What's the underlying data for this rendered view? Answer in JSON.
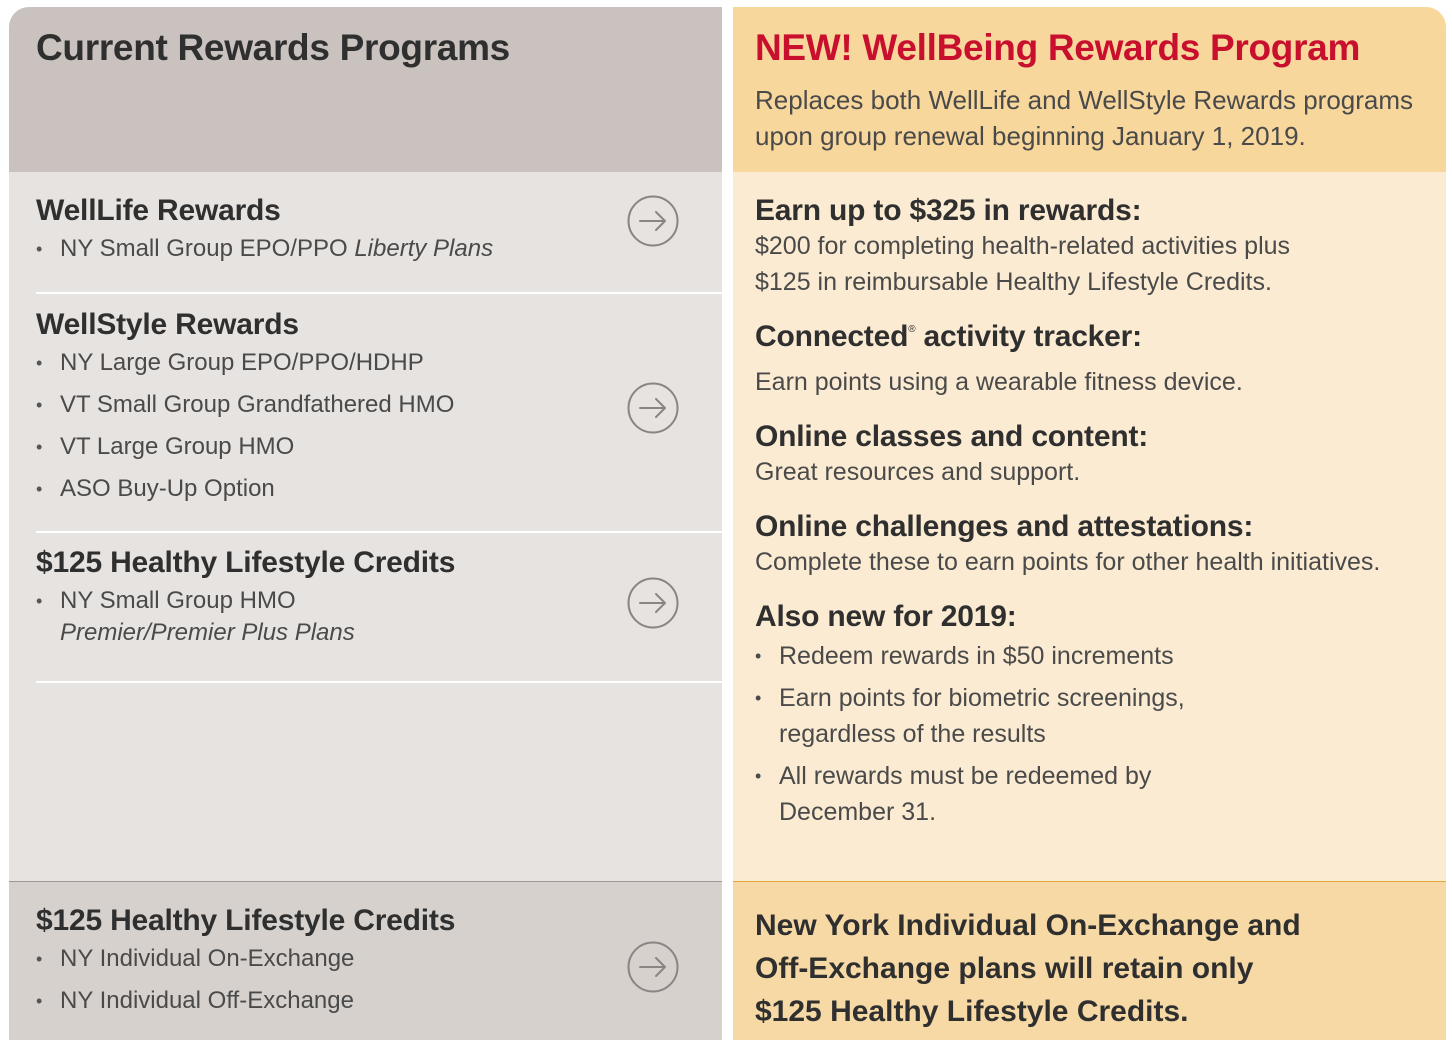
{
  "left": {
    "title": "Current Rewards Programs",
    "programs": [
      {
        "name": "WellLife Rewards",
        "items": [
          {
            "text": "NY Small Group EPO/PPO ",
            "italic": "Liberty Plans"
          }
        ]
      },
      {
        "name": "WellStyle Rewards",
        "items": [
          {
            "text": "NY Large Group EPO/PPO/HDHP"
          },
          {
            "text": "VT Small Group Grandfathered HMO"
          },
          {
            "text": "VT Large Group HMO"
          },
          {
            "text": "ASO Buy-Up Option"
          }
        ]
      },
      {
        "name": "$125 Healthy Lifestyle Credits",
        "items": [
          {
            "text": "NY Small Group HMO",
            "italic": "Premier/Premier Plus Plans"
          }
        ]
      }
    ],
    "footer": {
      "name": "$125 Healthy Lifestyle Credits",
      "items": [
        {
          "text": "NY Individual On-Exchange"
        },
        {
          "text": "NY Individual Off-Exchange"
        }
      ]
    },
    "arrow_icon": "arrow-right-circle-icon"
  },
  "right": {
    "title_prefix": "NEW!",
    "title_rest": " WellBeing Rewards Program",
    "subtitle_line1": "Replaces both WellLife and WellStyle Rewards programs",
    "subtitle_line2": "upon group renewal beginning January 1, 2019.",
    "features": [
      {
        "heading": "Earn up to $325 in rewards:",
        "lines": [
          "$200 for completing health-related activities plus",
          "$125 in reimbursable Healthy Lifestyle Credits."
        ]
      },
      {
        "heading_main": "Connected",
        "heading_sup": "®",
        "heading_rest": " activity tracker:",
        "lines": [
          "Earn points using a wearable fitness device."
        ]
      },
      {
        "heading": "Online classes and content:",
        "lines": [
          "Great resources and support."
        ]
      },
      {
        "heading": "Online challenges and attestations:",
        "lines": [
          "Complete these to earn points for other health initiatives."
        ]
      },
      {
        "heading": "Also new for 2019:",
        "bullets": [
          [
            "Redeem rewards in $50 increments"
          ],
          [
            "Earn points for biometric screenings,",
            "regardless of the results"
          ],
          [
            "All rewards must be redeemed by",
            "December 31."
          ]
        ]
      }
    ],
    "footer_lines": [
      "New York Individual On-Exchange and",
      "Off-Exchange plans will retain only",
      "$125 Healthy Lifestyle Credits."
    ]
  },
  "colors": {
    "left_header_bg": "#c9c2bf",
    "left_body_bg": "#e6e3e1",
    "left_footer_bg": "#d6d1cd",
    "right_header_bg": "#f7d79b",
    "right_body_bg": "#fbebd2",
    "right_footer_bg": "#f7d9a6",
    "accent_red": "#c8102e",
    "arrow_gray": "#8a8583"
  }
}
